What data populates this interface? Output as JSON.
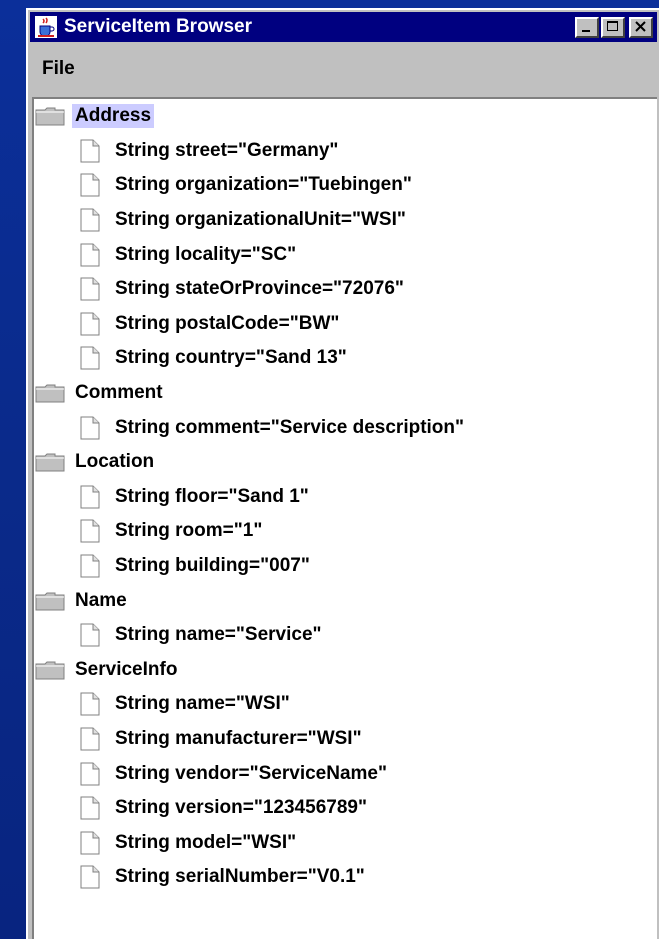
{
  "window": {
    "title": "ServiceItem Browser",
    "app_icon": "java-cup-icon",
    "buttons": [
      "minimize",
      "maximize",
      "close"
    ]
  },
  "menubar": {
    "items": [
      "File"
    ]
  },
  "tree": {
    "selected": "Address",
    "nodes": [
      {
        "label": "Address",
        "icon": "folder-icon",
        "children": [
          "String street=\"Germany\"",
          "String organization=\"Tuebingen\"",
          "String organizationalUnit=\"WSI\"",
          "String locality=\"SC\"",
          "String stateOrProvince=\"72076\"",
          "String postalCode=\"BW\"",
          "String country=\"Sand 13\""
        ]
      },
      {
        "label": "Comment",
        "icon": "folder-icon",
        "children": [
          "String comment=\"Service description\""
        ]
      },
      {
        "label": "Location",
        "icon": "folder-icon",
        "children": [
          "String floor=\"Sand 1\"",
          "String room=\"1\"",
          "String building=\"007\""
        ]
      },
      {
        "label": "Name",
        "icon": "folder-icon",
        "children": [
          "String name=\"Service\""
        ]
      },
      {
        "label": "ServiceInfo",
        "icon": "folder-icon",
        "children": [
          "String name=\"WSI\"",
          "String manufacturer=\"WSI\"",
          "String vendor=\"ServiceName\"",
          "String version=\"123456789\"",
          "String model=\"WSI\"",
          "String serialNumber=\"V0.1\""
        ]
      }
    ]
  },
  "colors": {
    "desktop": "#0a2a8a",
    "titlebar": "#000080",
    "window_face": "#c0c0c0",
    "tree_bg": "#ffffff",
    "selection": "#ccccff"
  }
}
